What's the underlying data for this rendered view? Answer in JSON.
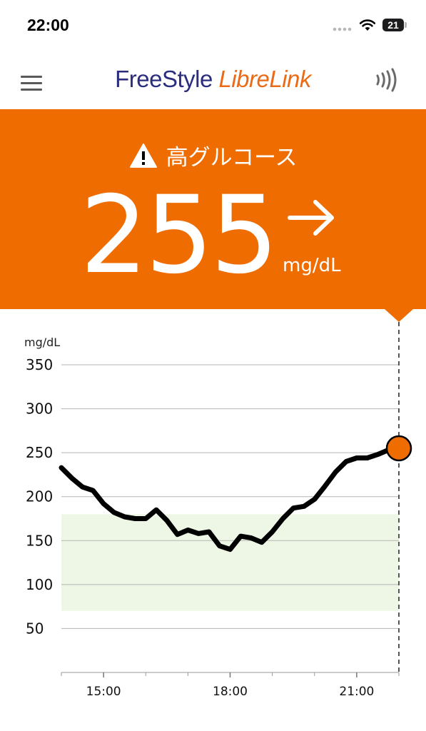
{
  "status_bar": {
    "time": "22:00",
    "battery": "21",
    "signal_icon": "cellular-dots",
    "wifi_icon": "wifi-icon"
  },
  "header": {
    "logo_part1": "FreeStyle",
    "logo_part2": "LibreLink",
    "menu_icon": "menu-icon",
    "scan_icon": "nfc-scan-icon"
  },
  "alert": {
    "title": "高グルコース",
    "value": "255",
    "unit": "mg/dL",
    "trend": "arrow-right",
    "warning_icon": "warning-icon"
  },
  "colors": {
    "alert_bg": "#ef6c00",
    "target_range": "#eef6e6",
    "line": "#000000",
    "dot": "#ef6c00",
    "brand_blue": "#2b2e7f",
    "brand_orange": "#ea6a16"
  },
  "chart_data": {
    "type": "line",
    "ylabel": "mg/dL",
    "yticks": [
      350,
      300,
      250,
      200,
      150,
      100,
      50
    ],
    "ylim": [
      0,
      350
    ],
    "xlim": [
      "14:00",
      "22:00"
    ],
    "xtick_labels": [
      "15:00",
      "18:00",
      "21:00"
    ],
    "target_range": [
      70,
      180
    ],
    "current": {
      "time": "22:00",
      "value": 255
    },
    "series": [
      {
        "x": [
          "14:00",
          "14:15",
          "14:30",
          "14:45",
          "15:00",
          "15:15",
          "15:30",
          "15:45",
          "16:00",
          "16:15",
          "16:30",
          "16:45",
          "17:00",
          "17:15",
          "17:30",
          "17:45",
          "18:00",
          "18:15",
          "18:30",
          "18:45",
          "19:00",
          "19:15",
          "19:30",
          "19:45",
          "20:00",
          "20:15",
          "20:30",
          "20:45",
          "21:00",
          "21:15",
          "21:30",
          "21:45",
          "22:00"
        ],
        "values": [
          233,
          221,
          211,
          207,
          192,
          182,
          177,
          175,
          175,
          185,
          173,
          157,
          162,
          158,
          160,
          144,
          140,
          155,
          153,
          148,
          160,
          175,
          187,
          189,
          197,
          212,
          228,
          240,
          244,
          244,
          248,
          253,
          255
        ]
      }
    ]
  }
}
